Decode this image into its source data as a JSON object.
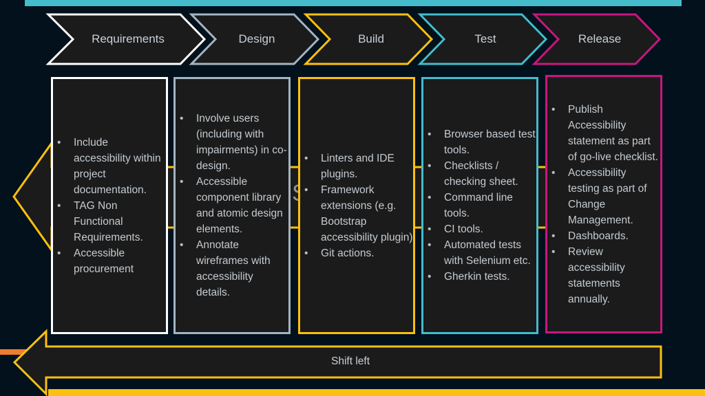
{
  "colors": {
    "background": "#02111b",
    "box_fill": "#1b1b1b",
    "requirements": "#ffffff",
    "design": "#a5b4c0",
    "build": "#fcc010",
    "test": "#45bccc",
    "release": "#c8177e",
    "shift_left": "#fcc010",
    "accent_top": "#45bccc",
    "accent_orange": "#ef7d2f"
  },
  "phases": [
    {
      "label": "Requirements",
      "items": [
        "Include accessibility within project documentation.",
        "TAG Non Functional Requirements.",
        "Accessible procurement"
      ]
    },
    {
      "label": "Design",
      "items": [
        "Involve users (including with impairments) in co-design.",
        "Accessible component library and atomic design elements.",
        "Annotate wireframes with accessibility details."
      ]
    },
    {
      "label": "Build",
      "items": [
        "Linters and IDE plugins.",
        "Framework extensions (e.g. Bootstrap accessibility plugin)",
        "Git actions."
      ]
    },
    {
      "label": "Test",
      "items": [
        "Browser based test tools.",
        "Checklists / checking sheet.",
        "Command line tools.",
        "CI tools.",
        "Automated tests with Selenium etc.",
        "Gherkin tests."
      ]
    },
    {
      "label": "Release",
      "items": [
        "Publish Accessibility statement as part of go-live checklist.",
        "Accessibility testing as part of Change Management.",
        "Dashboards.",
        "Review accessibility statements annually."
      ]
    }
  ],
  "shift_left": {
    "label": "Shift left"
  },
  "background_arrow": {
    "partial_text": "S"
  }
}
